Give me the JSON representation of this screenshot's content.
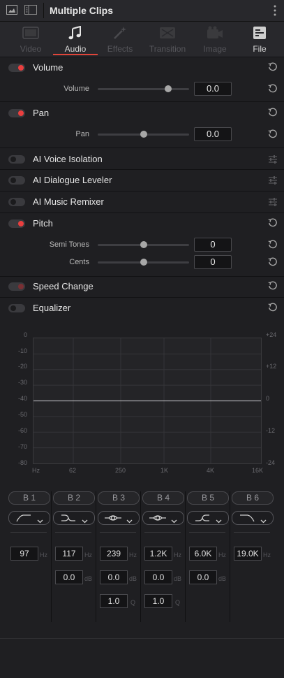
{
  "header": {
    "title": "Multiple Clips"
  },
  "tabs": [
    {
      "label": "Video",
      "icon": "film-icon",
      "state": "disabled"
    },
    {
      "label": "Audio",
      "icon": "music-note-icon",
      "state": "active"
    },
    {
      "label": "Effects",
      "icon": "magic-wand-icon",
      "state": "disabled"
    },
    {
      "label": "Transition",
      "icon": "transition-icon",
      "state": "disabled"
    },
    {
      "label": "Image",
      "icon": "camera-icon",
      "state": "disabled"
    },
    {
      "label": "File",
      "icon": "file-icon",
      "state": "enabled"
    }
  ],
  "volume": {
    "title": "Volume",
    "param_label": "Volume",
    "value": "0.0",
    "level": 0.77
  },
  "pan": {
    "title": "Pan",
    "param_label": "Pan",
    "value": "0.0",
    "level": 0.5
  },
  "ai_voice": {
    "title": "AI Voice Isolation"
  },
  "ai_dialogue": {
    "title": "AI Dialogue Leveler"
  },
  "ai_music": {
    "title": "AI Music Remixer"
  },
  "pitch": {
    "title": "Pitch",
    "semi_label": "Semi Tones",
    "semi_value": "0",
    "semi_level": 0.5,
    "cents_label": "Cents",
    "cents_value": "0",
    "cents_level": 0.5
  },
  "speed": {
    "title": "Speed Change"
  },
  "equalizer": {
    "title": "Equalizer",
    "left_axis": [
      "0",
      "-10",
      "-20",
      "-30",
      "-40",
      "-50",
      "-60",
      "-70",
      "-80"
    ],
    "right_axis": [
      "+24",
      "+12",
      "0",
      "-12",
      "-24"
    ],
    "freq_axis": [
      "Hz",
      "62",
      "250",
      "1K",
      "4K",
      "16K"
    ],
    "bands": [
      {
        "label": "B 1",
        "filter": "low-cut-filter-icon",
        "freq": "97",
        "freq_unit": "Hz"
      },
      {
        "label": "B 2",
        "filter": "low-shelf-filter-icon",
        "freq": "117",
        "freq_unit": "Hz",
        "gain": "0.0",
        "gain_unit": "dB"
      },
      {
        "label": "B 3",
        "filter": "bell-filter-icon",
        "freq": "239",
        "freq_unit": "Hz",
        "gain": "0.0",
        "gain_unit": "dB",
        "q": "1.0",
        "q_unit": "Q"
      },
      {
        "label": "B 4",
        "filter": "bell-filter-icon",
        "freq": "1.2K",
        "freq_unit": "Hz",
        "gain": "0.0",
        "gain_unit": "dB",
        "q": "1.0",
        "q_unit": "Q"
      },
      {
        "label": "B 5",
        "filter": "high-shelf-filter-icon",
        "freq": "6.0K",
        "freq_unit": "Hz",
        "gain": "0.0",
        "gain_unit": "dB"
      },
      {
        "label": "B 6",
        "filter": "high-cut-filter-icon",
        "freq": "19.0K",
        "freq_unit": "Hz"
      }
    ]
  },
  "colors": {
    "accent": "#e0453a",
    "toggle_on": "#ea3f3f",
    "panel": "#1f1f22"
  }
}
